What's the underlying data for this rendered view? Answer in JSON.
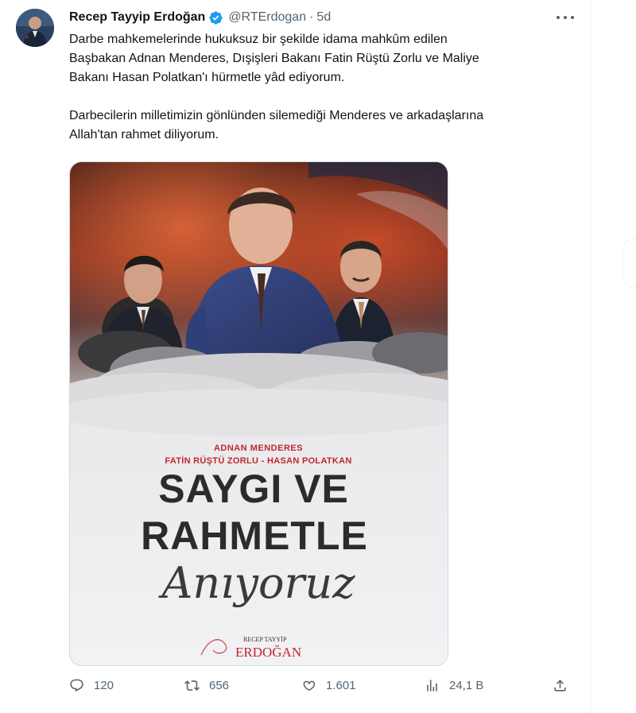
{
  "tweet": {
    "display_name": "Recep Tayyip Erdoğan",
    "handle": "@RTErdogan",
    "separator": "·",
    "time": "5d",
    "paragraphs": [
      "Darbe mahkemelerinde hukuksuz bir şekilde idama mahkûm edilen\nBaşbakan Adnan Menderes, Dışişleri Bakanı Fatin Rüştü Zorlu ve Maliye\nBakanı Hasan Polatkan'ı hürmetle yâd ediyorum.",
      "Darbecilerin milletimizin gönlünden silemediği Menderes ve arkadaşlarına\nAllah'tan rahmet diliyorum."
    ]
  },
  "poster": {
    "name_line1": "ADNAN MENDERES",
    "name_line2": "FATİN RÜŞTÜ ZORLU  -  HASAN POLATKAN",
    "headline_1": "SAYGI VE",
    "headline_2": "RAHMETLE",
    "script_word": "Anıyoruz",
    "signature_small": "RECEP TAYYİP",
    "signature_big": "ERDOĞAN"
  },
  "actions": {
    "replies": "120",
    "reposts": "656",
    "likes": "1.601",
    "views": "24,1 B"
  },
  "colors": {
    "verified": "#1d9bf0",
    "icon_gray": "#536471",
    "text": "#0f1419",
    "poster_red": "#c0272d",
    "poster_dark": "#2b2b2b"
  }
}
